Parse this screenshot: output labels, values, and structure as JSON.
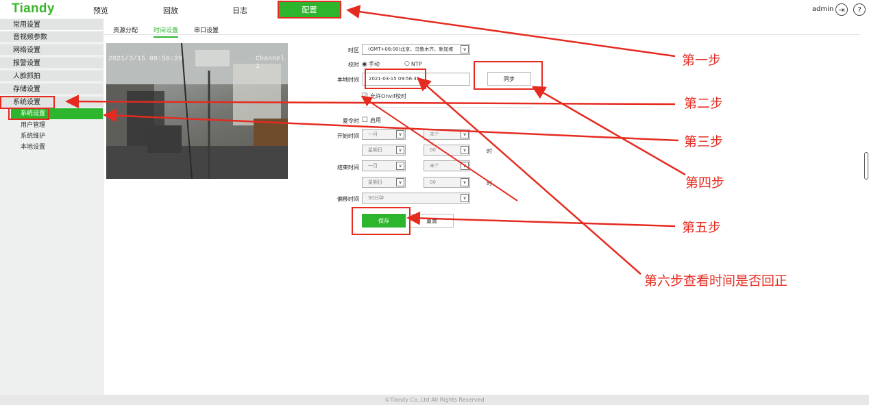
{
  "brand": "Tiandy",
  "nav": {
    "preview": "预览",
    "playback": "回放",
    "log": "日志",
    "config": "配置"
  },
  "user": {
    "name": "admin",
    "logout_icon": "logout-icon",
    "help_glyph": "?"
  },
  "sidebar": {
    "items": [
      "常用设置",
      "音视频参数",
      "网络设置",
      "报警设置",
      "人脸抓拍",
      "存储设置",
      "系统设置"
    ],
    "subitems": [
      "系统设置",
      "用户管理",
      "系统维护",
      "本地设置"
    ]
  },
  "tabs": [
    "资源分配",
    "时间设置",
    "串口设置"
  ],
  "video": {
    "timestamp": "2021/3/15 09:56:29",
    "channel": "Channel 1"
  },
  "form": {
    "timezone_label": "时区",
    "timezone_value": "(GMT+08:00)北京、乌鲁木齐、新加坡",
    "sync_label": "校时",
    "sync_manual": "手动",
    "sync_ntp": "NTP",
    "local_time_label": "本地时间",
    "local_time_value": "2021-03-15 09:56:31",
    "sync_button": "同步",
    "onvif_label": "允许Onvif校时",
    "dst_label": "夏令时",
    "dst_enable": "启用",
    "start_label": "开始时间",
    "end_label": "结束时间",
    "month": "一月",
    "week": "末个",
    "weekday": "星期日",
    "hour": "00",
    "hour_unit": "时",
    "offset_label": "偏移时间",
    "offset_value": "30分钟",
    "save_button": "保存",
    "reset_button": "重置"
  },
  "annotations": [
    "第一步",
    "第二步",
    "第三步",
    "第四步",
    "第五步",
    "第六步查看时间是否回正"
  ],
  "footer": "©Tiandy Co.,Ltd All Rights Reserved",
  "colors": {
    "accent": "#2db52d",
    "annotation": "#e52b20"
  }
}
